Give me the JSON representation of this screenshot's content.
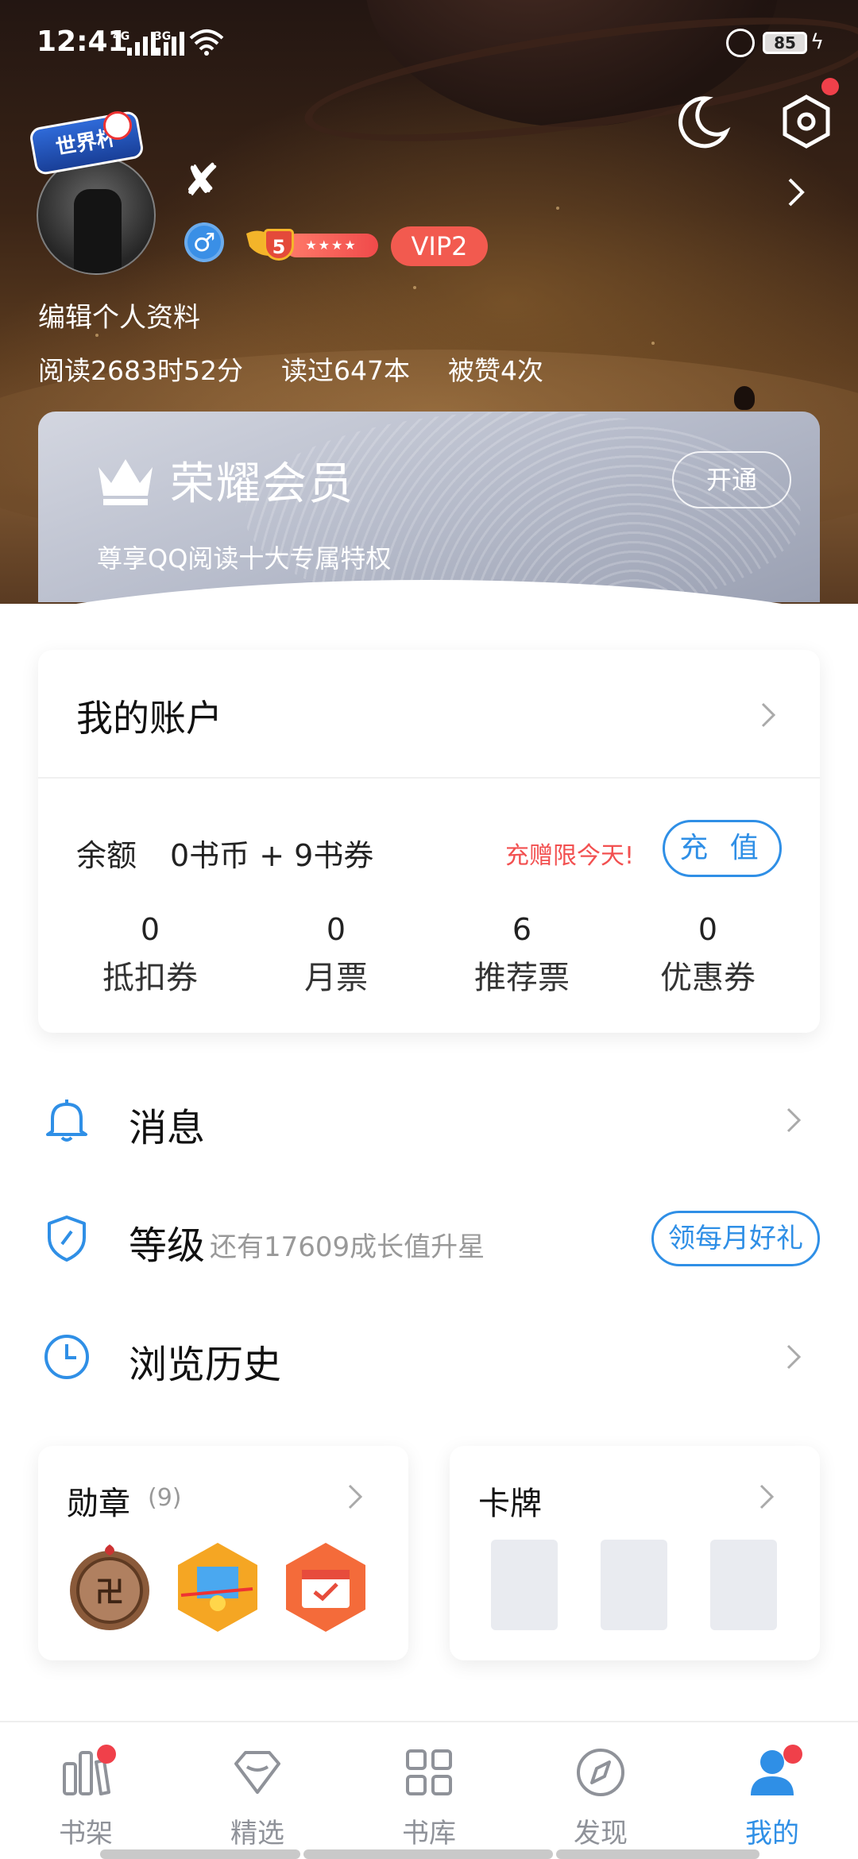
{
  "status_bar": {
    "time": "12:41",
    "net1": "4G",
    "net2": "3G",
    "battery": "85"
  },
  "profile": {
    "avatar_badge": "世界杯",
    "name": "✘",
    "gender_symbol": "♂",
    "level": "5",
    "level_stars": "★★★★",
    "vip": "VIP2",
    "edit_label": "编辑个人资料",
    "stats": {
      "read_time": "阅读2683时52分",
      "books_read": "读过647本",
      "likes": "被赞4次"
    }
  },
  "membership": {
    "title": "荣耀会员",
    "subtitle": "尊享QQ阅读十大专属特权",
    "button": "开通"
  },
  "account": {
    "title": "我的账户",
    "balance_label": "余额",
    "balance_value": "0书币 + 9书券",
    "promo": "充赠限今天!",
    "recharge": "充 值",
    "tickets": [
      {
        "value": "0",
        "label": "抵扣券"
      },
      {
        "value": "0",
        "label": "月票"
      },
      {
        "value": "6",
        "label": "推荐票"
      },
      {
        "value": "0",
        "label": "优惠券"
      }
    ]
  },
  "menu": {
    "messages": "消息",
    "level": "等级",
    "level_hint": "还有17609成长值升星",
    "level_button": "领每月好礼",
    "history": "浏览历史"
  },
  "medals": {
    "title": "勋章",
    "count": "(9)"
  },
  "cards": {
    "title": "卡牌"
  },
  "tabs": [
    {
      "label": "书架",
      "icon": "bookshelf-icon"
    },
    {
      "label": "精选",
      "icon": "diamond-icon"
    },
    {
      "label": "书库",
      "icon": "grid-icon"
    },
    {
      "label": "发现",
      "icon": "compass-icon"
    },
    {
      "label": "我的",
      "icon": "person-icon"
    }
  ],
  "colors": {
    "accent": "#2f8fe6",
    "vip": "#f25a4f",
    "promo": "#f25050",
    "notification": "#f0404a"
  }
}
